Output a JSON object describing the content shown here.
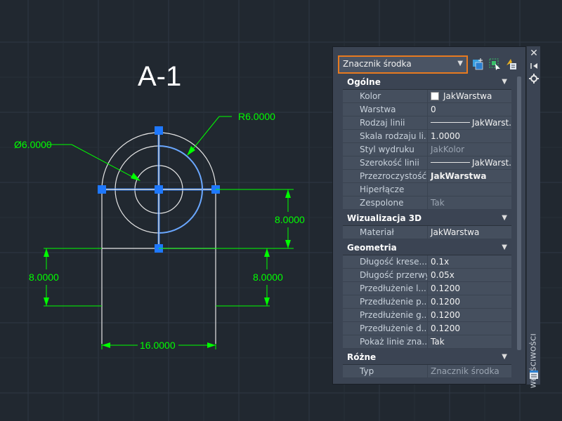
{
  "drawing": {
    "title": "A-1",
    "dimensions": {
      "radius": "R6.0000",
      "diameter": "Ø6.0000",
      "height_right": "8.0000",
      "height_left": "8.0000",
      "height_inner": "8.0000",
      "width_bottom": "16.0000"
    }
  },
  "palette": {
    "selector": {
      "label": "Znacznik środka"
    },
    "sidebar_title": "WŁAŚCIWOŚCI",
    "sections": {
      "general": {
        "title": "Ogólne",
        "rows": [
          {
            "name": "Kolor",
            "value": "JakWarstwa"
          },
          {
            "name": "Warstwa",
            "value": "0"
          },
          {
            "name": "Rodzaj linii",
            "value": "JakWarst..."
          },
          {
            "name": "Skala rodzaju li...",
            "value": "1.0000"
          },
          {
            "name": "Styl wydruku",
            "value": "JakKolor"
          },
          {
            "name": "Szerokość linii",
            "value": "JakWarst..."
          },
          {
            "name": "Przezroczystość",
            "value": "JakWarstwa"
          },
          {
            "name": "Hiperłącze",
            "value": ""
          },
          {
            "name": "Zespolone",
            "value": "Tak"
          }
        ]
      },
      "visual3d": {
        "title": "Wizualizacja 3D",
        "rows": [
          {
            "name": "Materiał",
            "value": "JakWarstwa"
          }
        ]
      },
      "geometry": {
        "title": "Geometria",
        "rows": [
          {
            "name": "Długość krese...",
            "value": "0.1x"
          },
          {
            "name": "Długość przerwy",
            "value": "0.05x"
          },
          {
            "name": "Przedłużenie l...",
            "value": "0.1200"
          },
          {
            "name": "Przedłużenie p...",
            "value": "0.1200"
          },
          {
            "name": "Przedłużenie g...",
            "value": "0.1200"
          },
          {
            "name": "Przedłużenie d...",
            "value": "0.1200"
          },
          {
            "name": "Pokaż linie zna...",
            "value": "Tak"
          }
        ]
      },
      "misc": {
        "title": "Różne",
        "rows": [
          {
            "name": "Typ",
            "value": "Znacznik środka"
          }
        ]
      }
    }
  },
  "colors": {
    "background": "#212830",
    "grid": "#2f3844",
    "geometry": "#ffffff",
    "dimension": "#00ff00",
    "selection": "#1e78ff",
    "selector_border": "#e87a1f"
  }
}
